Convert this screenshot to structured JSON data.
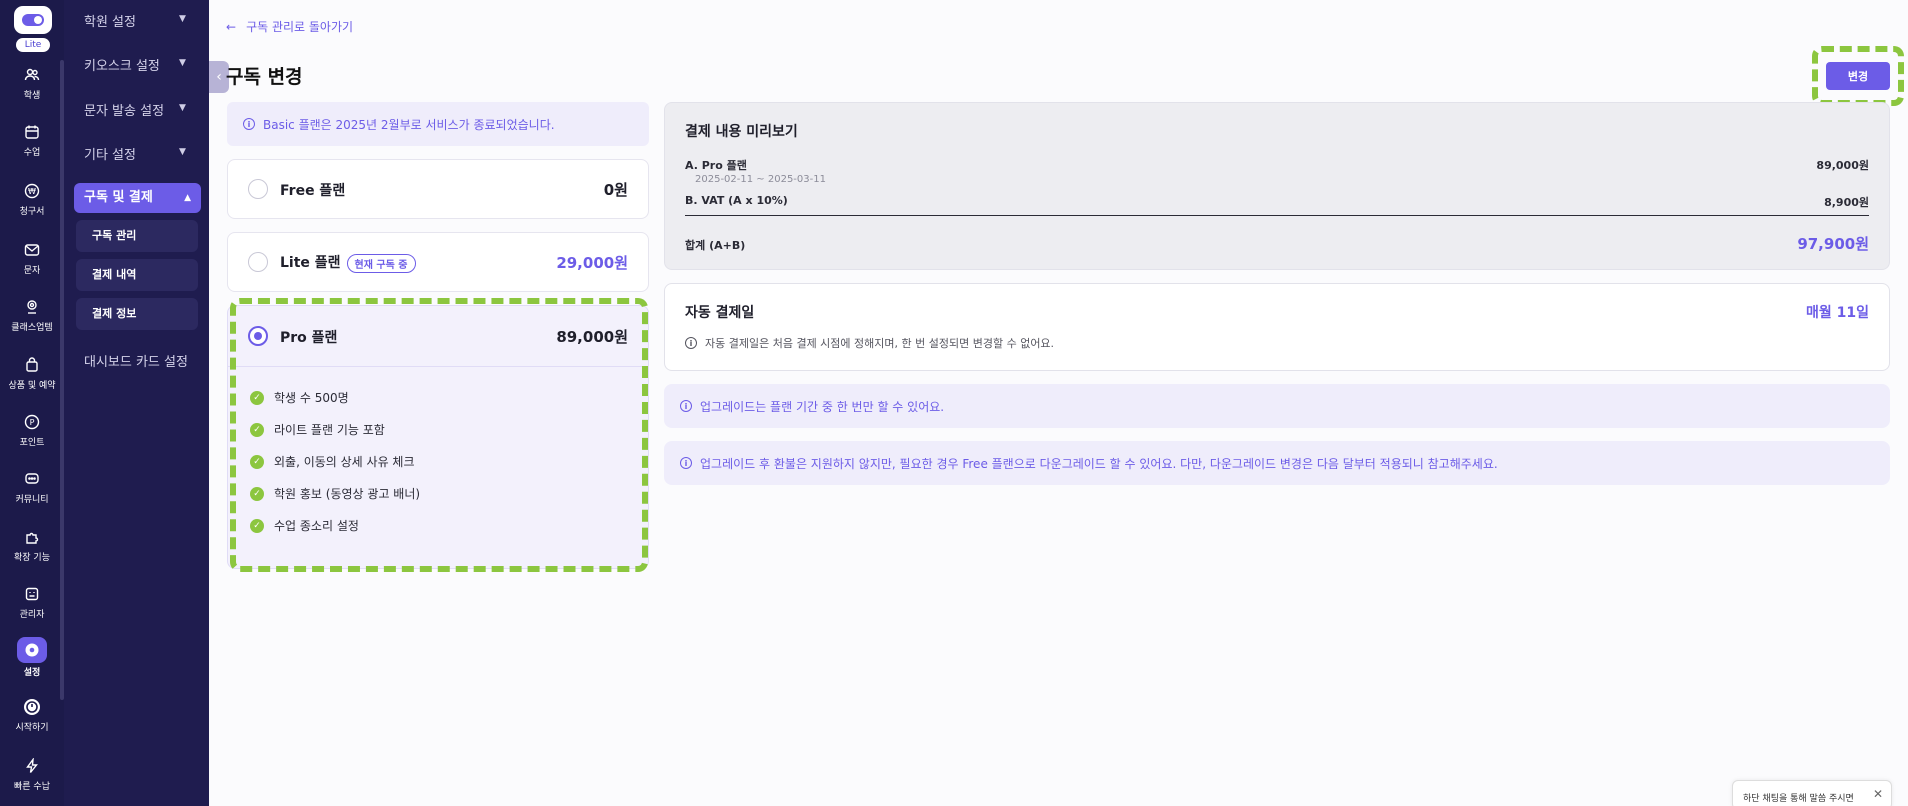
{
  "rail": {
    "badge": "Lite",
    "items": [
      {
        "label": "학생",
        "icon": "users-icon"
      },
      {
        "label": "수업",
        "icon": "calendar-icon"
      },
      {
        "label": "청구서",
        "icon": "won-icon"
      },
      {
        "label": "문자",
        "icon": "mail-icon"
      },
      {
        "label": "클래스업템",
        "icon": "pin-icon"
      },
      {
        "label": "상품 및 예약",
        "icon": "bag-icon"
      },
      {
        "label": "포인트",
        "icon": "point-icon"
      },
      {
        "label": "커뮤니티",
        "icon": "chat-icon"
      },
      {
        "label": "확장 기능",
        "icon": "puzzle-icon"
      },
      {
        "label": "관리자",
        "icon": "admin-icon"
      },
      {
        "label": "설정",
        "icon": "gear-icon"
      },
      {
        "label": "시작하기",
        "icon": "start-icon"
      },
      {
        "label": "빠른 수납",
        "icon": "bolt-icon"
      }
    ]
  },
  "subnav": {
    "groups": [
      "학원 설정",
      "키오스크 설정",
      "문자 발송 설정",
      "기타 설정"
    ],
    "active_group": "구독 및 결제",
    "subitems": [
      "구독 관리",
      "결제 내역",
      "결제 정보"
    ],
    "dashboard": "대시보드 카드 설정"
  },
  "header": {
    "back_label": "구독 관리로 돌아가기",
    "title": "구독 변경",
    "change_button": "변경"
  },
  "notice_basic": "Basic 플랜은 2025년 2월부로 서비스가 종료되었습니다.",
  "plans": [
    {
      "name": "Free 플랜",
      "price": "0원"
    },
    {
      "name": "Lite 플랜",
      "badge": "현재 구독 중",
      "price": "29,000원"
    },
    {
      "name": "Pro 플랜",
      "price": "89,000원",
      "features": [
        "학생 수 500명",
        "라이트 플랜 기능 포함",
        "외출, 이동의 상세 사유 체크",
        "학원 홍보 (동영상 광고 배너)",
        "수업 종소리 설정"
      ]
    }
  ],
  "preview": {
    "title": "결제 내용 미리보기",
    "a_label": "A. Pro 플랜",
    "a_value": "89,000원",
    "a_period": "2025-02-11 ~ 2025-03-11",
    "b_label": "B. VAT (A x 10%)",
    "b_value": "8,900원",
    "total_label": "합계 (A+B)",
    "total_value": "97,900원"
  },
  "autopay": {
    "title": "자동 결제일",
    "value": "매월 11일",
    "desc": "자동 결제일은 처음 결제 시점에 정해지며, 한 번 설정되면 변경할 수 없어요."
  },
  "info1": "업그레이드는 플랜 기간 중 한 번만 할 수 있어요.",
  "info2": "업그레이드 후 환불은 지원하지 않지만, 필요한 경우 Free 플랜으로 다운그레이드 할 수 있어요. 다만, 다운그레이드 변경은 다음 달부터 적용되니 참고해주세요.",
  "toast": "하단 채팅을 통해 말씀 주시면",
  "colors": {
    "accent": "#6c5ce7",
    "highlight": "#8cc63f",
    "rail": "#1c1a4a"
  }
}
